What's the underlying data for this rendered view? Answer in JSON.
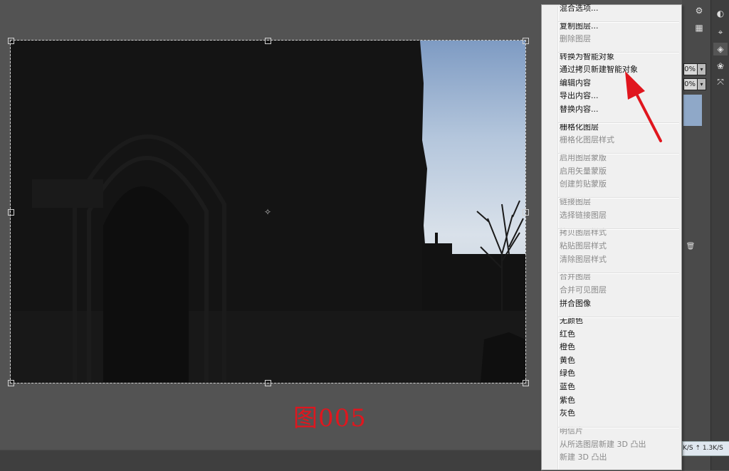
{
  "caption": "图005",
  "context_menu": {
    "items": [
      {
        "label": "混合选项...",
        "disabled": false
      },
      {
        "label": "复制图层...",
        "disabled": false
      },
      {
        "label": "删除图层",
        "disabled": true
      },
      {
        "label": "转换为智能对象",
        "disabled": false
      },
      {
        "label": "通过拷贝新建智能对象",
        "disabled": false
      },
      {
        "label": "编辑内容",
        "disabled": false
      },
      {
        "label": "导出内容...",
        "disabled": false
      },
      {
        "label": "替换内容...",
        "disabled": false
      },
      {
        "label": "栅格化图层",
        "disabled": false
      },
      {
        "label": "栅格化图层样式",
        "disabled": true
      },
      {
        "label": "启用图层蒙版",
        "disabled": true
      },
      {
        "label": "启用矢量蒙版",
        "disabled": true
      },
      {
        "label": "创建剪贴蒙版",
        "disabled": true
      },
      {
        "label": "链接图层",
        "disabled": true
      },
      {
        "label": "选择链接图层",
        "disabled": true
      },
      {
        "label": "拷贝图层样式",
        "disabled": true
      },
      {
        "label": "粘贴图层样式",
        "disabled": true
      },
      {
        "label": "清除图层样式",
        "disabled": true
      },
      {
        "label": "合并图层",
        "disabled": true
      },
      {
        "label": "合并可见图层",
        "disabled": true
      },
      {
        "label": "拼合图像",
        "disabled": false
      },
      {
        "label": "无颜色",
        "disabled": false
      },
      {
        "label": "红色",
        "disabled": false
      },
      {
        "label": "橙色",
        "disabled": false
      },
      {
        "label": "黄色",
        "disabled": false
      },
      {
        "label": "绿色",
        "disabled": false
      },
      {
        "label": "蓝色",
        "disabled": false
      },
      {
        "label": "紫色",
        "disabled": false
      },
      {
        "label": "灰色",
        "disabled": false
      },
      {
        "label": "明信片",
        "disabled": true
      },
      {
        "label": "从所选图层新建 3D 凸出",
        "disabled": true
      },
      {
        "label": "新建 3D 凸出",
        "disabled": true
      }
    ]
  },
  "right_panel": {
    "opacity_value": "0%",
    "fill_value": "0%"
  },
  "status_bar": {
    "text": "K/S ⇡ 1.3K/S"
  },
  "colors": {
    "caption": "#e0161e",
    "arrow": "#e0161e",
    "workspace": "#535353"
  },
  "icons": [
    "crosshair-icon",
    "arrow-annotation-icon",
    "layers-icon",
    "adjustments-icon",
    "paths-icon",
    "channels-icon",
    "styles-icon",
    "swatches-icon",
    "trash-icon"
  ]
}
